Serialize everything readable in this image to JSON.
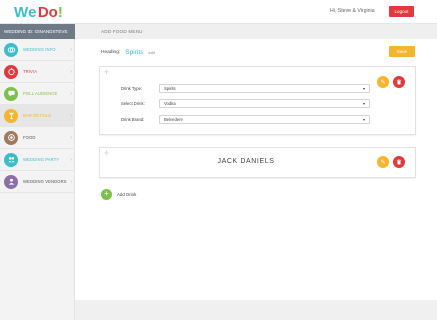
{
  "header": {
    "logo": {
      "we": "We",
      "do": "Do",
      "bang": "!"
    },
    "greeting": "Hi, Steve & Virginia",
    "logout_label": "Logout"
  },
  "subheader": {
    "wedding_id": "WEDDING ID: GINANDSTEVE",
    "section_title": "ADD FOOD MENU"
  },
  "sidebar": {
    "items": [
      {
        "label": "WEDDING INFO",
        "icon": "rings-icon",
        "color": "#3dbdc8"
      },
      {
        "label": "TRIVIA",
        "icon": "trivia-icon",
        "color": "#e0393e"
      },
      {
        "label": "POLL AUDIENCE",
        "icon": "chat-icon",
        "color": "#7cc04b"
      },
      {
        "label": "BAR DETAILS",
        "icon": "glass-icon",
        "color": "#f5b52e"
      },
      {
        "label": "FOOD",
        "icon": "food-icon",
        "color": "#9c7b5e"
      },
      {
        "label": "WEDDING PARTY",
        "icon": "party-icon",
        "color": "#3dbdc8"
      },
      {
        "label": "WEDDING VENDORS",
        "icon": "vendors-icon",
        "color": "#8a6fa8"
      }
    ],
    "active_index": 3
  },
  "main": {
    "heading_label": "Heading:",
    "heading_value": "Spirits",
    "heading_edit": "edit",
    "save_label": "Save",
    "form": {
      "drink_type_label": "Drink Type:",
      "drink_type_value": "Spirits",
      "select_drink_label": "Select Drink:",
      "select_drink_value": "Vodka",
      "drink_brand_label": "Drink Brand:",
      "drink_brand_value": "Belvedere"
    },
    "drink_name": "JACK DANIELS",
    "add_drink_label": "Add Drink"
  },
  "colors": {
    "accent_teal": "#3dbdc8",
    "red": "#e0393e",
    "orange": "#f5b52e",
    "green": "#7cc04b"
  }
}
